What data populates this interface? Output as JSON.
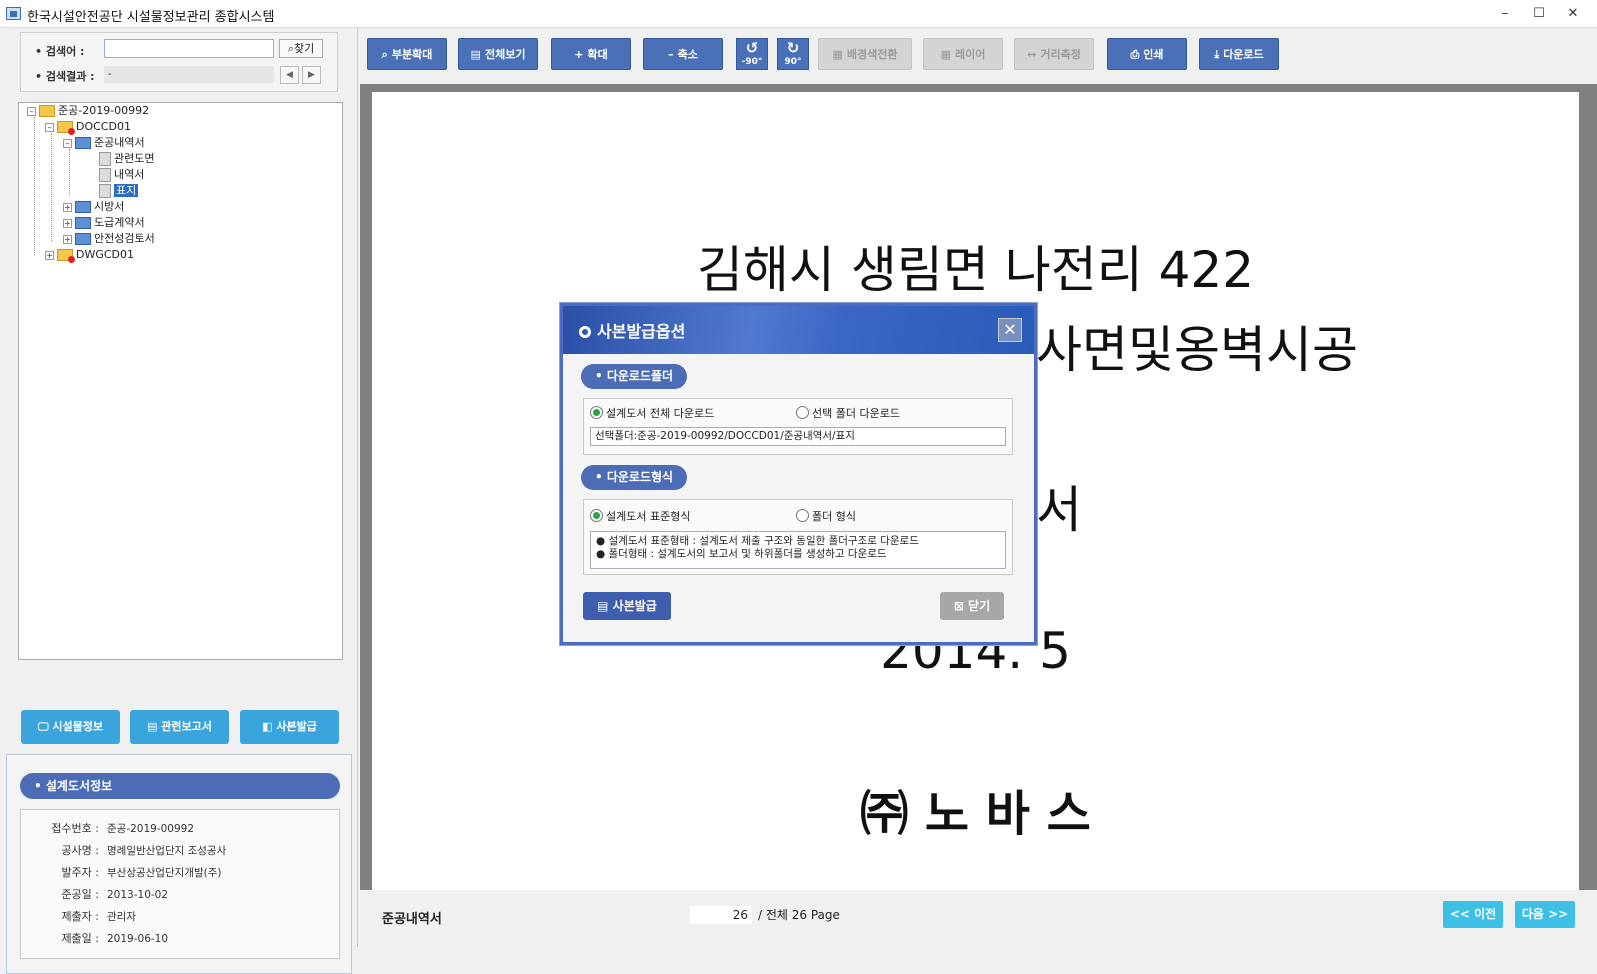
{
  "window": {
    "title": "한국시설안전공단 시설물정보관리 종합시스템",
    "minimize": "–",
    "maximize": "☐",
    "close": "✕"
  },
  "search": {
    "keyword_label": "• 검색어  :",
    "find_button": "⌕찾기",
    "result_label": "• 검색결과 :",
    "result_value": "-",
    "prev": "◀",
    "next": "▶"
  },
  "tree": {
    "root": "준공-2019-00992",
    "doc": "DOCCD01",
    "completion": "준공내역서",
    "related_drawing": "관련도면",
    "statement": "내역서",
    "cover": "표지",
    "spec": "시방서",
    "contract": "도급계약서",
    "safety": "안전성검토서",
    "dwg": "DWGCD01"
  },
  "side_buttons": {
    "facility": "🖵 시설물정보",
    "report": "▤ 관련보고서",
    "copy": "◧ 사본발급"
  },
  "info": {
    "heading": "• 설계도서정보",
    "rows": [
      {
        "k": "접수번호 :",
        "v": "준공-2019-00992"
      },
      {
        "k": "공사명 :",
        "v": "명례일반산업단지 조성공사"
      },
      {
        "k": "발주자 :",
        "v": "부산상공산업단지개발(주)"
      },
      {
        "k": "준공일 :",
        "v": "2013-10-02"
      },
      {
        "k": "제출자 :",
        "v": "관리자"
      },
      {
        "k": "제출일 :",
        "v": "2019-06-10"
      }
    ]
  },
  "toolbar": {
    "partial_zoom": "부분확대",
    "full_view": "전체보기",
    "zoom_in": "확대",
    "zoom_out": "축소",
    "rot_left": "-90°",
    "rot_right": "90°",
    "bg_switch": "배경색전환",
    "layer": "레이어",
    "measure": "거리측정",
    "print": "인쇄",
    "download": "다운로드"
  },
  "document": {
    "line1": "김해시 생림면 나전리 422",
    "line2": "사면및옹벽시공",
    "line3": "서",
    "date": "2014. 5",
    "company": "㈜ 노 바 스"
  },
  "footer": {
    "title": "준공내역서",
    "page": "26",
    "total": "/ 전체  26 Page",
    "prev": "<< 이전",
    "next": "다음 >>"
  },
  "modal": {
    "title": "사본발급옵션",
    "close": "✕",
    "section1": "• 다운로드폴더",
    "opt_all": "설계도서 전체 다운로드",
    "opt_selected": "선택 폴더 다운로드",
    "selected_path": "선택폴더:준공-2019-00992/DOCCD01/준공내역서/표지",
    "section2": "• 다운로드형식",
    "fmt_standard": "설계도서 표준형식",
    "fmt_folder": "폴더 형식",
    "desc1": "● 설계도서 표준형태 : 설계도서 제출 구조와 동일한 폴더구조로 다운로드",
    "desc2": "● 폴더형태 : 설계도서의 보고서 및 하위폴더를 생성하고 다운로드",
    "issue_button": "▤ 사본발급",
    "close_button": "⊠ 닫기"
  }
}
